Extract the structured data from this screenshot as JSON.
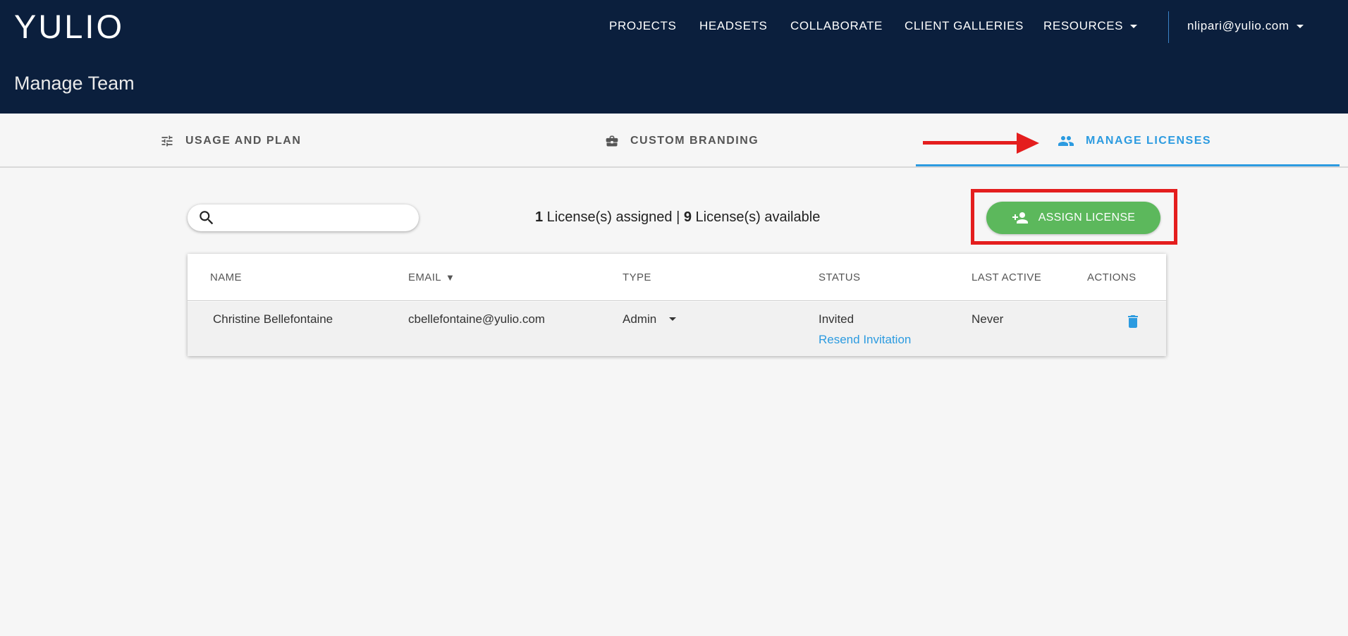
{
  "header": {
    "logo": "YULIO",
    "page_title": "Manage Team",
    "nav": [
      {
        "label": "PROJECTS"
      },
      {
        "label": "HEADSETS"
      },
      {
        "label": "COLLABORATE"
      },
      {
        "label": "CLIENT GALLERIES"
      },
      {
        "label": "RESOURCES"
      }
    ],
    "user_email": "nlipari@yulio.com"
  },
  "tabs": [
    {
      "label": "USAGE AND PLAN",
      "icon": "sliders-icon",
      "active": false
    },
    {
      "label": "CUSTOM BRANDING",
      "icon": "briefcase-icon",
      "active": false
    },
    {
      "label": "MANAGE LICENSES",
      "icon": "people-icon",
      "active": true
    }
  ],
  "toolbar": {
    "search_placeholder": "",
    "assigned_count": "1",
    "assigned_text": " License(s) assigned | ",
    "available_count": "9",
    "available_text": " License(s) available",
    "assign_label": "ASSIGN LICENSE"
  },
  "table": {
    "headers": {
      "name": "NAME",
      "email": "EMAIL",
      "type": "TYPE",
      "status": "STATUS",
      "last_active": "LAST ACTIVE",
      "actions": "ACTIONS"
    },
    "sort_indicator": "▼",
    "rows": [
      {
        "name": "Christine Bellefontaine",
        "email": "cbellefontaine@yulio.com",
        "type": "Admin",
        "status": "Invited",
        "status_action": "Resend Invitation",
        "last_active": "Never"
      }
    ]
  },
  "colors": {
    "header_bg": "#0b1f3d",
    "accent": "#2c9be0",
    "assign_button": "#5cb85c",
    "annotation": "#e41e1e"
  }
}
